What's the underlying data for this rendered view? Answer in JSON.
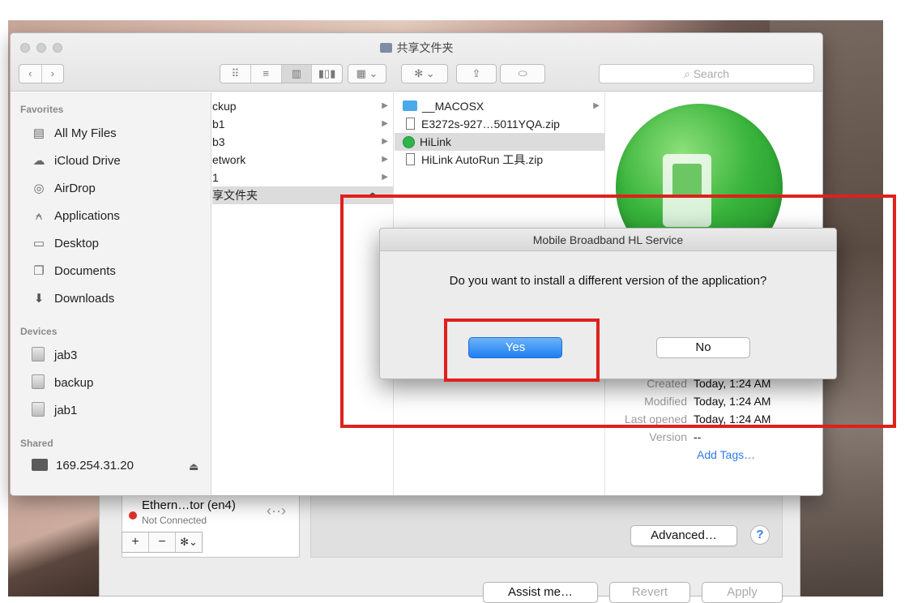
{
  "window": {
    "title": "共享文件夹"
  },
  "toolbar": {
    "view_icons": [
      "⠿",
      "≡",
      "▥",
      "▮▯▮"
    ],
    "arrange_icon": "▦",
    "action_icon": "✻",
    "share_icon": "⇪",
    "tag_icon": "⬭",
    "search_placeholder": "Search"
  },
  "sidebar": {
    "favorites_label": "Favorites",
    "favorites": [
      {
        "label": "All My Files",
        "icon": "all-files-icon"
      },
      {
        "label": "iCloud Drive",
        "icon": "cloud-icon"
      },
      {
        "label": "AirDrop",
        "icon": "airdrop-icon"
      },
      {
        "label": "Applications",
        "icon": "applications-icon"
      },
      {
        "label": "Desktop",
        "icon": "desktop-icon"
      },
      {
        "label": "Documents",
        "icon": "documents-icon"
      },
      {
        "label": "Downloads",
        "icon": "downloads-icon"
      }
    ],
    "devices_label": "Devices",
    "devices": [
      "jab3",
      "backup",
      "jab1"
    ],
    "shared_label": "Shared",
    "shared": [
      {
        "label": "169.254.31.20"
      }
    ],
    "eject_glyph": "⏏"
  },
  "column1": [
    {
      "label": "ckup"
    },
    {
      "label": "b1"
    },
    {
      "label": "b3"
    },
    {
      "label": "etwork"
    },
    {
      "label": "1"
    },
    {
      "label": "享文件夹"
    }
  ],
  "column2": [
    {
      "label": "__MACOSX"
    },
    {
      "label": "E3272s-927…5011YQA.zip"
    },
    {
      "label": "HiLink"
    },
    {
      "label": "HiLink AutoRun 工具.zip"
    }
  ],
  "preview": {
    "meta": [
      {
        "key": "Created",
        "value": "Today, 1:24 AM"
      },
      {
        "key": "Modified",
        "value": "Today, 1:24 AM"
      },
      {
        "key": "Last opened",
        "value": "Today, 1:24 AM"
      },
      {
        "key": "Version",
        "value": "--"
      }
    ],
    "add_tags": "Add Tags…"
  },
  "dialog": {
    "title": "Mobile Broadband HL Service",
    "message": "Do you want to install a different version of the application?",
    "yes_label": "Yes",
    "no_label": "No"
  },
  "network": {
    "service_name": "Ethern…tor (en4)",
    "service_status": "Not Connected",
    "list_buttons": [
      "+",
      "−",
      "✻⌄"
    ],
    "advanced_label": "Advanced…",
    "help_label": "?",
    "assist_label": "Assist me…",
    "revert_label": "Revert",
    "apply_label": "Apply"
  },
  "colors": {
    "highlight": "#e0201c",
    "default_button": "#1f7ef1",
    "hilink_green": "#39b43c",
    "disconnected": "#e0322b"
  }
}
